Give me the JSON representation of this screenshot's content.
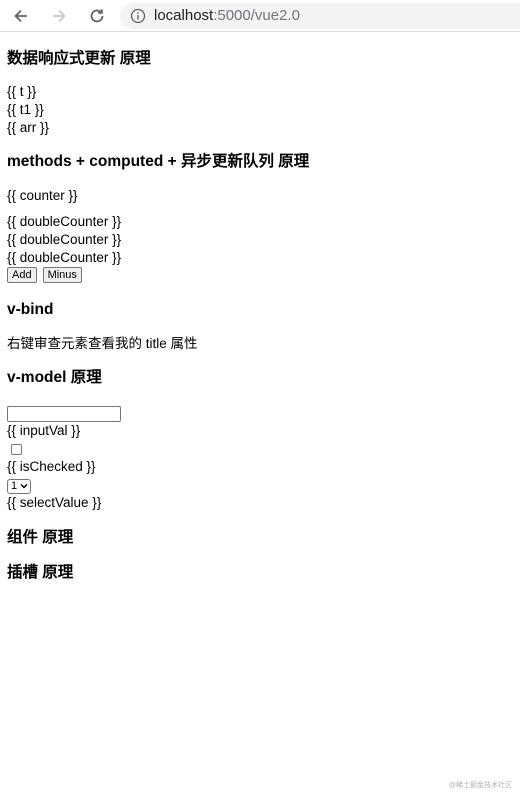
{
  "browser": {
    "url_host": "localhost",
    "url_path": ":5000/vue2.0"
  },
  "sections": {
    "reactive": {
      "heading": "数据响应式更新 原理",
      "lines": [
        "{{ t }}",
        "{{ t1 }}",
        "{{ arr }}"
      ]
    },
    "methods": {
      "heading": "methods + computed + 异步更新队列 原理",
      "counter": "{{ counter }}",
      "double_lines": [
        "{{ doubleCounter }}",
        "{{ doubleCounter }}",
        "{{ doubleCounter }}"
      ],
      "add_label": "Add",
      "minus_label": "Minus"
    },
    "vbind": {
      "heading": "v-bind",
      "text": "右键审查元素查看我的 title 属性"
    },
    "vmodel": {
      "heading": "v-model 原理",
      "input_value": "",
      "input_val_text": "{{ inputVal }}",
      "checkbox_checked": false,
      "is_checked_text": "{{ isChecked }}",
      "select_value": "1",
      "select_value_text": "{{ selectValue }}"
    },
    "component": {
      "heading": "组件 原理"
    },
    "slot": {
      "heading": "插槽 原理"
    }
  },
  "icons": {
    "back": "arrow-left-icon",
    "forward": "arrow-right-icon",
    "reload": "reload-icon",
    "info": "info-icon",
    "dropdown": "chevron-down-icon"
  },
  "watermark": "@稀土掘金技术社区"
}
